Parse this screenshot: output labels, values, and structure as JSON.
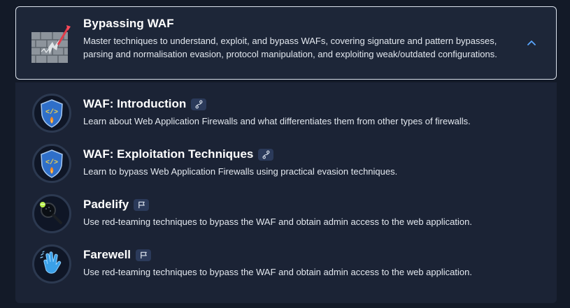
{
  "module": {
    "title": "Bypassing WAF",
    "description": "Master techniques to understand, exploit, and bypass WAFs, covering signature and pattern bypasses, parsing and normalisation evasion, protocol manipulation, and exploiting weak/outdated configurations.",
    "toggle_icon": "chevron-up-icon",
    "expanded": true
  },
  "rooms": [
    {
      "title": "WAF: Introduction",
      "description": "Learn about Web Application Firewalls and what differentiates them from other types of firewalls.",
      "type_icon": "walkthrough-icon",
      "icon": "shield-fire-icon"
    },
    {
      "title": "WAF: Exploitation Techniques",
      "description": "Learn to bypass Web Application Firewalls using practical evasion techniques.",
      "type_icon": "walkthrough-icon",
      "icon": "shield-fire-icon"
    },
    {
      "title": "Padelify",
      "description": "Use red-teaming techniques to bypass the WAF and obtain admin access to the web application.",
      "type_icon": "flag-icon",
      "icon": "padel-racket-icon"
    },
    {
      "title": "Farewell",
      "description": "Use red-teaming techniques to bypass the WAF and obtain admin access to the web application.",
      "type_icon": "flag-icon",
      "icon": "waving-hand-icon"
    }
  ],
  "colors": {
    "background": "#131a28",
    "card": "#1d2638",
    "panel": "#1b2335",
    "accent": "#5aa7ff",
    "badge": "#2b3a5a"
  }
}
